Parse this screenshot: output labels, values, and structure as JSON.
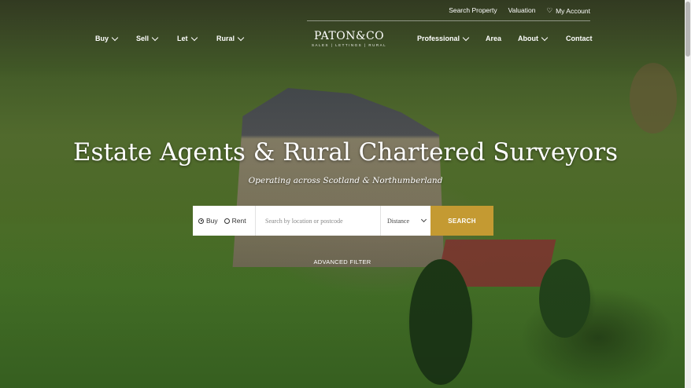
{
  "utility_nav": {
    "search_property": "Search Property",
    "valuation": "Valuation",
    "my_account": "My Account"
  },
  "main_nav": {
    "buy": "Buy",
    "sell": "Sell",
    "let": "Let",
    "rural": "Rural",
    "professional": "Professional",
    "area": "Area",
    "about": "About",
    "contact": "Contact"
  },
  "logo": {
    "name": "PATON&CO",
    "tagline": "SALES | LETTINGS | RURAL"
  },
  "hero": {
    "headline": "Estate Agents & Rural Chartered Surveyors",
    "subline": "Operating across Scotland & Northumberland"
  },
  "search": {
    "radio_buy": "Buy",
    "radio_rent": "Rent",
    "selected": "Buy",
    "location_placeholder": "Search by location or postcode",
    "distance_value": "Distance",
    "button_label": "SEARCH",
    "advanced_filter": "ADVANCED FILTER"
  },
  "colors": {
    "accent": "#c49a32"
  }
}
